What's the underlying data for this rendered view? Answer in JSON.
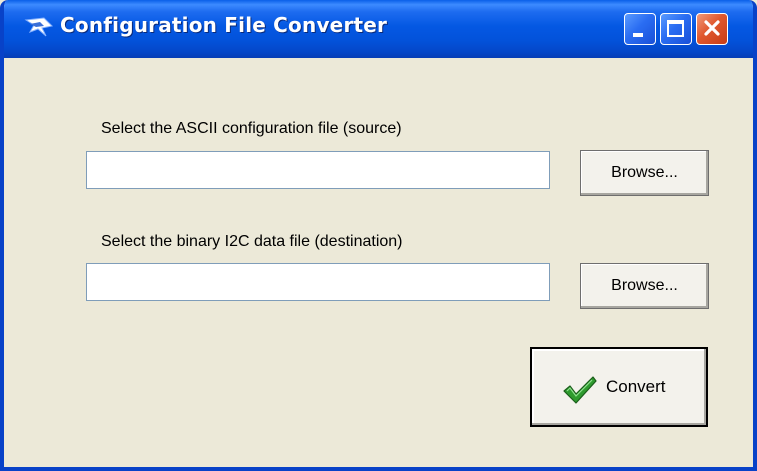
{
  "window": {
    "title": "Configuration File Converter",
    "icon": "app-arrow-icon",
    "controls": {
      "minimize": "minimize-icon",
      "maximize": "maximize-icon",
      "close": "close-icon"
    }
  },
  "source": {
    "label": "Select the ASCII configuration file (source)",
    "value": "",
    "browse_label": "Browse..."
  },
  "destination": {
    "label": "Select the binary I2C data file (destination)",
    "value": "",
    "browse_label": "Browse..."
  },
  "convert": {
    "label": "Convert",
    "icon": "checkmark-icon"
  },
  "colors": {
    "titlebar": "#0458E3",
    "window_bg": "#ECE9D8",
    "close_button": "#E0582E",
    "check": "#2E8B2E"
  }
}
